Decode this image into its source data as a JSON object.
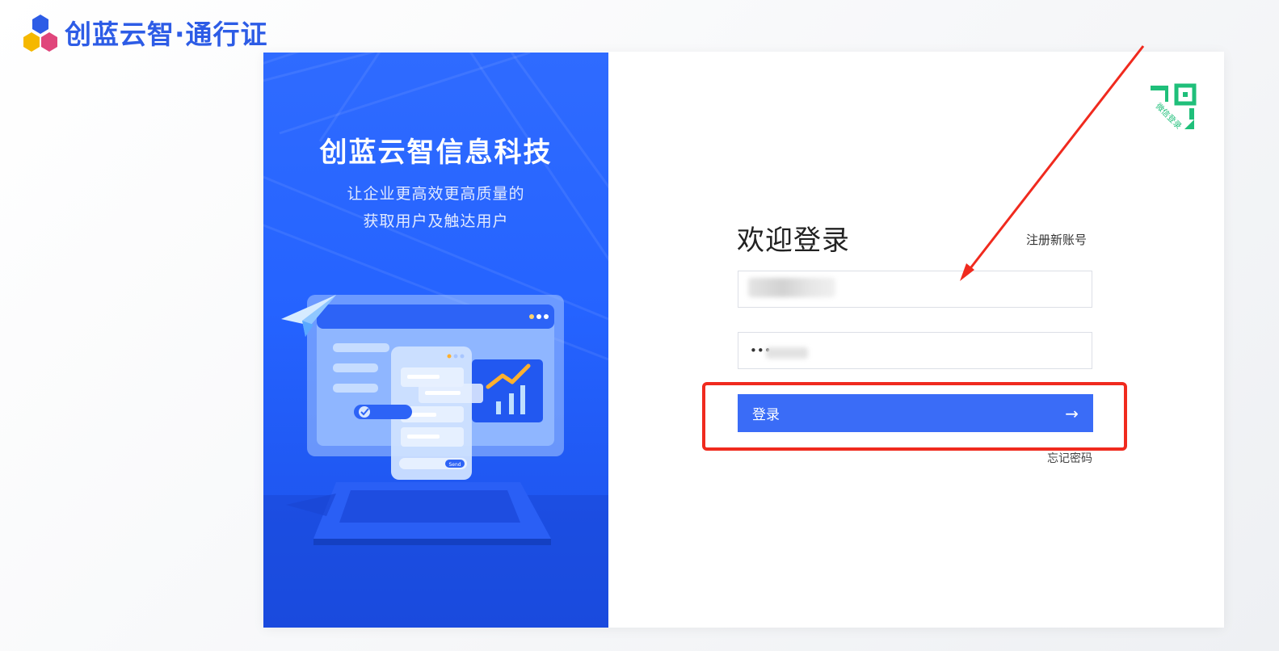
{
  "header": {
    "logo_text": "创蓝云智·通行证",
    "logo_colors": [
      "#2d5ce6",
      "#f5b800",
      "#e0467b"
    ]
  },
  "promo": {
    "title": "创蓝云智信息科技",
    "slogan_line1": "让企业更高效更高质量的",
    "slogan_line2": "获取用户及触达用户",
    "illustration_button": "Send",
    "background": "#2563ff"
  },
  "wechat": {
    "label": "微信登录",
    "color": "#1fbf7a"
  },
  "login": {
    "title": "欢迎登录",
    "register_link": "注册新账号",
    "username_value": "",
    "password_value": "•••",
    "submit_label": "登录",
    "submit_icon": "arrow-right-icon",
    "forgot_link": "忘记密码",
    "accent": "#3a6cf7"
  },
  "annotation": {
    "color": "#f02a1e"
  }
}
